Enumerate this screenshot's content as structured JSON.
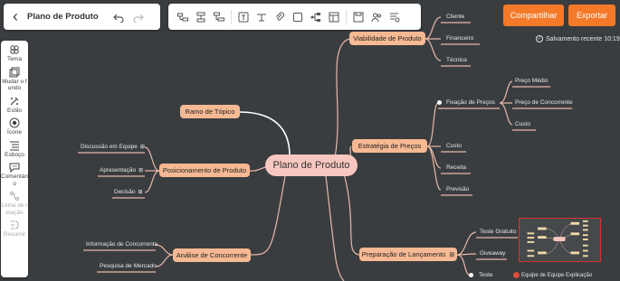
{
  "header": {
    "title": "Plano de Produto",
    "undo_icon": "undo-icon",
    "redo_icon": "redo-icon"
  },
  "toolbar": {
    "tools": [
      "subtopic-icon",
      "sibling-icon",
      "floating-topic-icon",
      "formula-icon",
      "relationship-icon",
      "attachment-icon",
      "boundary-icon",
      "structure-icon",
      "summary-icon",
      "save-icon",
      "collaborate-icon",
      "outline-icon"
    ]
  },
  "actions": {
    "share_label": "Compartilhar",
    "export_label": "Exportar",
    "accent": "#f47a2a"
  },
  "status": {
    "save_text": "Salvamento recente 10:19"
  },
  "sidebar": {
    "items": [
      {
        "label": "Tema",
        "icon": "theme-icon"
      },
      {
        "label": "Mudar o fundo",
        "icon": "background-icon"
      },
      {
        "label": "Estilo",
        "icon": "style-icon"
      },
      {
        "label": "Ícone",
        "icon": "icon-icon"
      },
      {
        "label": "Esboço",
        "icon": "outline-icon"
      },
      {
        "label": "Comentário",
        "icon": "comment-icon"
      },
      {
        "label": "Linha de relação",
        "icon": "relation-line-icon"
      },
      {
        "label": "Resumir",
        "icon": "summarize-icon"
      }
    ]
  },
  "map": {
    "root": "Plano de Produto",
    "topics": {
      "viabilidade": "Viabilidade de Produto",
      "ramo": "Ramo de Tópico",
      "estrategia": "Estratégia de Preços",
      "posicionamento": "Posicionamento de Produto",
      "analise": "Análise de Concorrente",
      "preparacao": "Preparação de Lançamento"
    },
    "viabilidade_children": [
      "Cliente",
      "Financeiro",
      "Técnica"
    ],
    "estrategia_children": [
      "Fixação de Preços",
      "Custo",
      "Receita",
      "Previsão"
    ],
    "fixacao_children": [
      "Preço Médio",
      "Preço de Concorrente",
      "Custo"
    ],
    "posicionamento_children": [
      "Discussão em Equipe",
      "Apresentação",
      "Decisão"
    ],
    "analise_children": [
      "Informação de Concorrente",
      "Pesquisa de Mercado"
    ],
    "preparacao_children": [
      "Teste Gratuito",
      "Giveaway",
      "Teste"
    ],
    "note_mark": "⊞",
    "overlap_text": "Equipe de Equipe Explicação"
  },
  "colors": {
    "canvas": "#3a3d40",
    "topic": "#f6b993",
    "root": "#f8c7c0",
    "line": "#e8b9a8"
  }
}
